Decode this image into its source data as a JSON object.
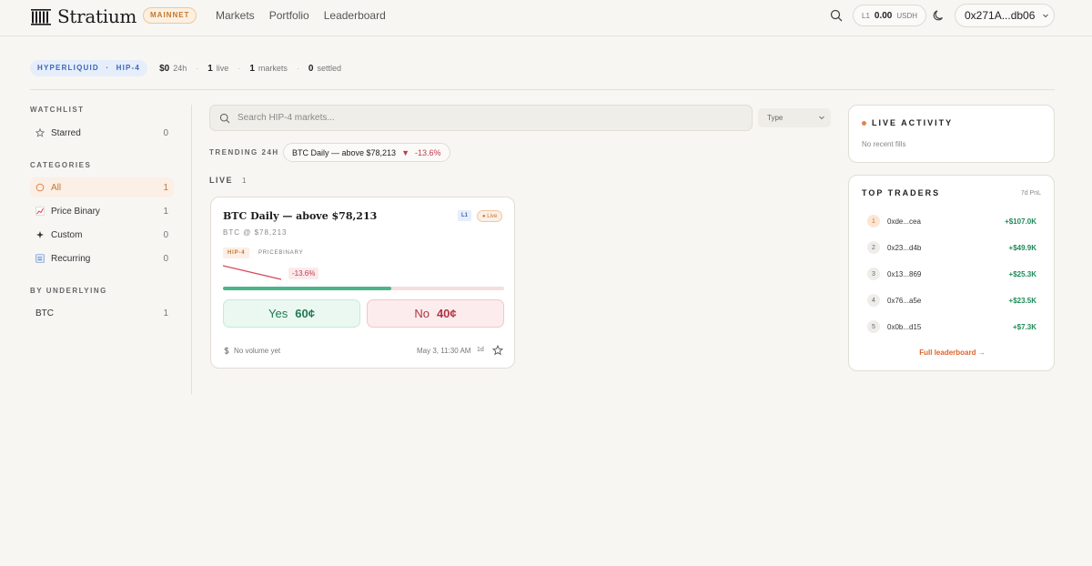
{
  "header": {
    "brand": "Stratium",
    "network": "MAINNET",
    "nav": [
      "Markets",
      "Portfolio",
      "Leaderboard"
    ],
    "balance": {
      "level": "L1",
      "amount": "0.00",
      "unit": "USDH"
    },
    "wallet": "0x271A...db06"
  },
  "stats": {
    "pill_a": "HYPERLIQUID",
    "pill_sep": "·",
    "pill_b": "HIP-4",
    "volume": "$0",
    "volume_label": "24h",
    "live": "1",
    "live_label": "live",
    "markets": "1",
    "markets_label": "markets",
    "settled": "0",
    "settled_label": "settled",
    "dot": "·"
  },
  "sidebar": {
    "watchlist_heading": "WATCHLIST",
    "starred": {
      "label": "Starred",
      "count": "0"
    },
    "categories_heading": "CATEGORIES",
    "categories": [
      {
        "label": "All",
        "count": "1"
      },
      {
        "label": "Price Binary",
        "count": "1"
      },
      {
        "label": "Custom",
        "count": "0"
      },
      {
        "label": "Recurring",
        "count": "0"
      }
    ],
    "underlying_heading": "BY UNDERLYING",
    "underlying": [
      {
        "label": "BTC",
        "count": "1"
      }
    ]
  },
  "search": {
    "placeholder": "Search HIP-4 markets..."
  },
  "type_filter": "Type",
  "trending": {
    "label": "TRENDING 24H",
    "title": "BTC Daily — above $78,213",
    "arrow": "▼",
    "change": "-13.6%"
  },
  "live_section": {
    "label": "LIVE",
    "count": "1"
  },
  "market_card": {
    "title": "BTC Daily — above $78,213",
    "level_tag": "L1",
    "live_tag": "● Live",
    "subtitle": "BTC @ $78,213",
    "tag_hip": "HIP-4",
    "tag_type": "PRICEBINARY",
    "change": "-13.6%",
    "yes_probability": 0.6,
    "yes_label": "Yes",
    "yes_price": "60¢",
    "no_label": "No",
    "no_price": "40¢",
    "volume": "No volume yet",
    "date": "May 3, 11:30 AM",
    "duration": "1d"
  },
  "live_activity": {
    "heading": "LIVE ACTIVITY",
    "empty": "No recent fills"
  },
  "top_traders": {
    "heading": "TOP TRADERS",
    "period": "7d PnL",
    "rows": [
      {
        "rank": "1",
        "addr": "0xde...cea",
        "pnl": "+$107.0K"
      },
      {
        "rank": "2",
        "addr": "0x23...d4b",
        "pnl": "+$49.9K"
      },
      {
        "rank": "3",
        "addr": "0x13...869",
        "pnl": "+$25.3K"
      },
      {
        "rank": "4",
        "addr": "0x76...a5e",
        "pnl": "+$23.5K"
      },
      {
        "rank": "5",
        "addr": "0x0b...d15",
        "pnl": "+$7.3K"
      }
    ],
    "link": "Full leaderboard →"
  },
  "colors": {
    "accent": "#e0642a",
    "yes": "#1f7a52",
    "no": "#b23344",
    "blue": "#3c66b3"
  }
}
